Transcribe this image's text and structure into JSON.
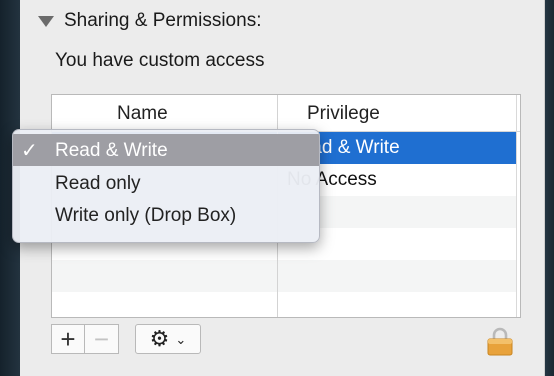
{
  "section": {
    "title": "Sharing & Permissions:"
  },
  "access": {
    "note": "You have custom access"
  },
  "table": {
    "headers": {
      "name": "Name",
      "privilege": "Privilege"
    },
    "rows": [
      {
        "privilege": "Read & Write",
        "selected": true
      },
      {
        "privilege": "No Access",
        "selected": false
      },
      {
        "privilege": "",
        "selected": false
      },
      {
        "privilege": "",
        "selected": false
      },
      {
        "privilege": "",
        "selected": false
      },
      {
        "privilege": "",
        "selected": false
      }
    ]
  },
  "toolbar": {
    "add_label": "+",
    "remove_label": "−",
    "gear_icon": "⚙",
    "chevron_icon": "⌄"
  },
  "menu": {
    "items": [
      {
        "label": "Read & Write",
        "checked": true,
        "check_mark": "✓"
      },
      {
        "label": "Read only",
        "checked": false
      },
      {
        "label": "Write only (Drop Box)",
        "checked": false
      }
    ]
  },
  "colors": {
    "selection": "#1f6fd1",
    "menu_highlight": "#9e9ea4",
    "lock": "#e8a23b"
  }
}
